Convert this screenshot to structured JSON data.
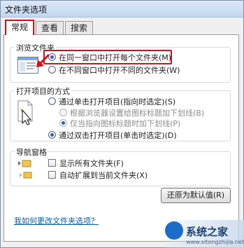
{
  "window": {
    "title": "文件夹选项"
  },
  "tabs": [
    {
      "label": "常规",
      "active": true
    },
    {
      "label": "查看",
      "active": false
    },
    {
      "label": "搜索",
      "active": false
    }
  ],
  "browse": {
    "title": "浏览文件夹",
    "option_same": "在同一窗口中打开每个文件夹(M)",
    "option_new": "在不同窗口中打开不同的文件夹(W)"
  },
  "click": {
    "title": "打开项目的方式",
    "single": "通过单击打开项目(指向时选定)(S)",
    "underline_browser": "根据浏览器设置给图标标题加下划线(B)",
    "underline_point": "仅当指向图标标题时加下划线(P)",
    "double": "通过双击打开项目(单击时选定)(D)"
  },
  "nav": {
    "title": "导航窗格",
    "show_all": "显示所有文件夹(F)",
    "auto_expand": "自动扩展到当前文件夹(X)"
  },
  "buttons": {
    "restore": "还原为默认值(R)"
  },
  "help_link": "我如何更改文件夹选项？",
  "watermark": {
    "text": "系统之家",
    "url": "www.xitongzhijia.net"
  },
  "colors": {
    "highlight": "#d0121b",
    "link": "#0c5ea8"
  }
}
